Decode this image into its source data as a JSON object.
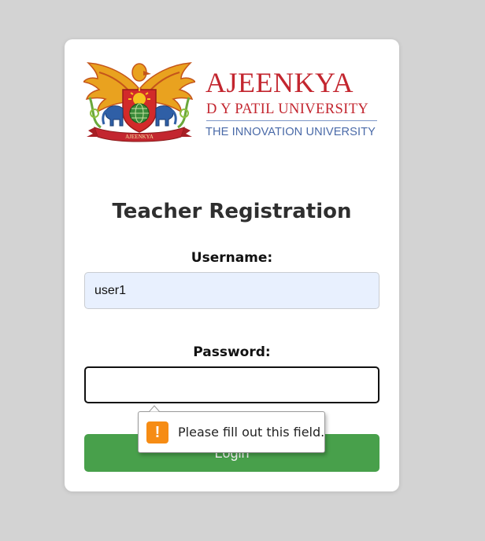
{
  "logo": {
    "main": "AJEENKYA",
    "sub": "D Y PATIL UNIVERSITY",
    "tagline": "THE INNOVATION UNIVERSITY",
    "ribbon": "AJEENKYA"
  },
  "form": {
    "title": "Teacher Registration",
    "username_label": "Username:",
    "username_value": "user1",
    "password_label": "Password:",
    "password_value": "",
    "login_label": "Login"
  },
  "validation": {
    "message": "Please fill out this field.",
    "icon": "!"
  },
  "colors": {
    "background": "#d3d3d3",
    "brand_red": "#c3262f",
    "brand_blue": "#4a6aa8",
    "button_green": "#48a04b",
    "autofill_blue": "#e8f0fe",
    "warning_orange": "#f68c14"
  }
}
